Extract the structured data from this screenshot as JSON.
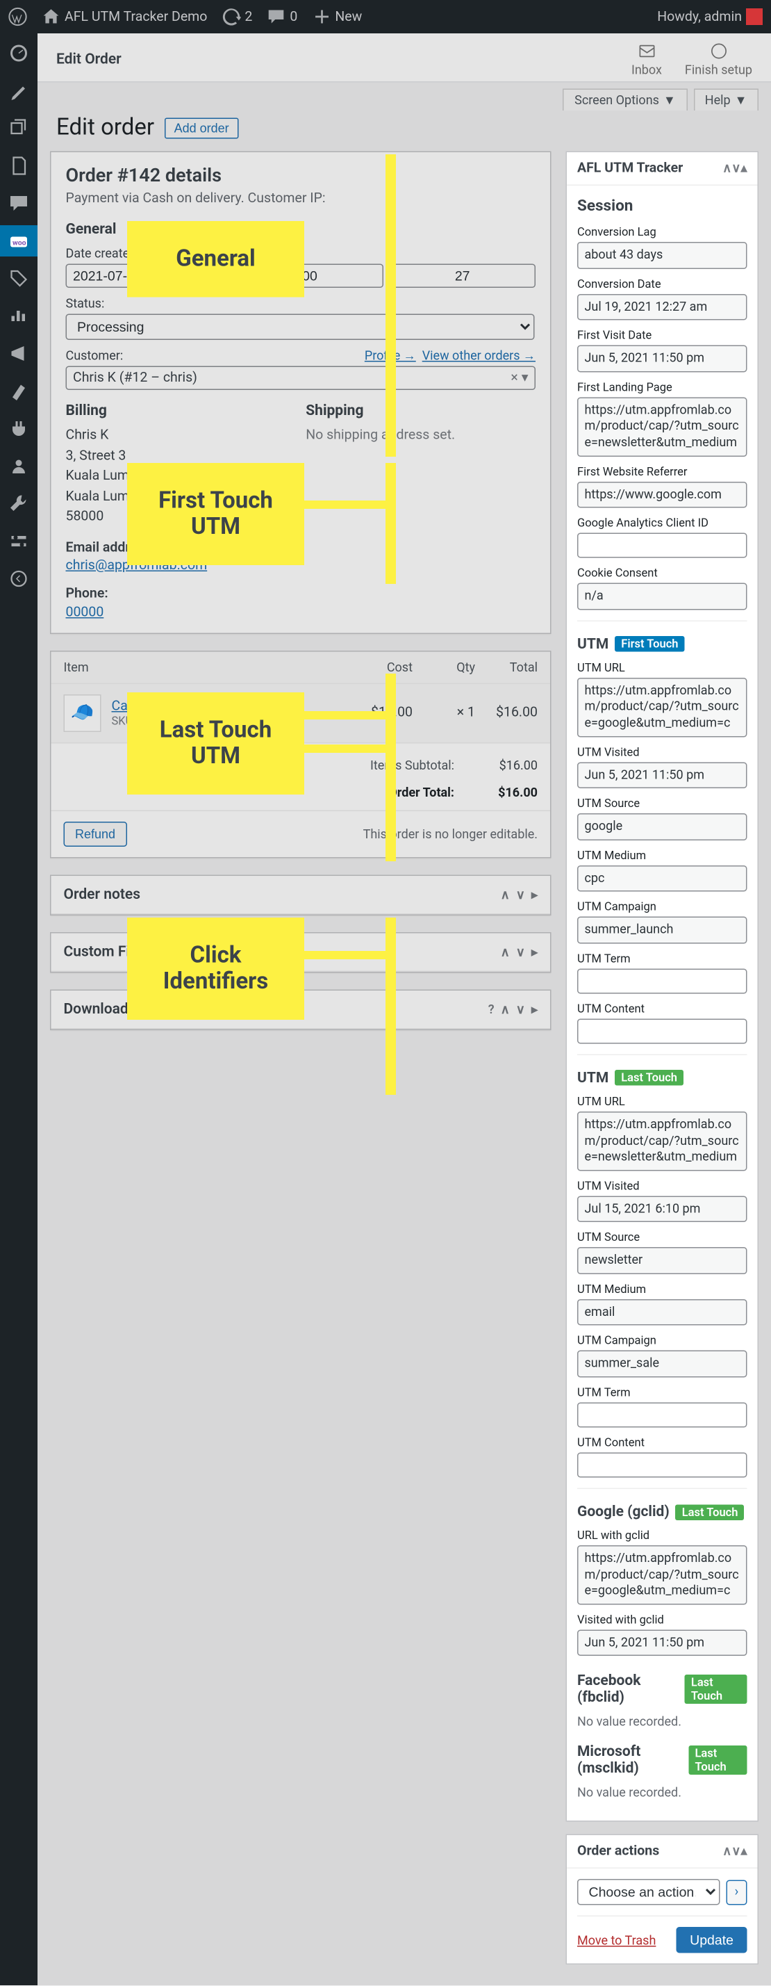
{
  "adminbar": {
    "site": "AFL UTM Tracker Demo",
    "updates": "2",
    "comments": "0",
    "new": "New",
    "howdy": "Howdy, admin"
  },
  "header": {
    "title": "Edit Order",
    "inbox": "Inbox",
    "finish": "Finish setup",
    "screen_options": "Screen Options",
    "help": "Help"
  },
  "page": {
    "title": "Edit order",
    "add": "Add order"
  },
  "order": {
    "heading": "Order #142 details",
    "sub": "Payment via Cash on delivery. Customer IP:",
    "general": "General",
    "date_label": "Date created:",
    "date": "2021-07-19",
    "at": "@",
    "hour": "00",
    "min": "27",
    "status_label": "Status:",
    "status": "Processing",
    "customer_label": "Customer:",
    "profile": "Profile →",
    "view_orders": "View other orders →",
    "customer": "Chris K (#12 – chris)",
    "billing": "Billing",
    "addr1": "Chris K",
    "addr2": "3, Street 3",
    "addr3": "Kuala Lumpur",
    "addr4": "Kuala Lumpur",
    "addr5": "58000",
    "email_label": "Email address:",
    "email": "chris@appfromlab.com",
    "phone_label": "Phone:",
    "phone": "00000",
    "shipping": "Shipping",
    "no_ship": "No shipping address set."
  },
  "items": {
    "col_item": "Item",
    "col_cost": "Cost",
    "col_qty": "Qty",
    "col_total": "Total",
    "name": "Cap",
    "sku": "SKU: woo-cap",
    "cost": "$16.00",
    "qty": "× 1",
    "total": "$16.00",
    "subtotal_label": "Items Subtotal:",
    "subtotal": "$16.00",
    "order_total_label": "Order Total:",
    "order_total": "$16.00",
    "refund": "Refund",
    "no_edit": "This order is no longer editable."
  },
  "boxes": {
    "notes": "Order notes",
    "custom": "Custom Fields",
    "download": "Downloadable product permissions"
  },
  "tracker": {
    "title": "AFL UTM Tracker",
    "session": "Session",
    "conv_lag_label": "Conversion Lag",
    "conv_lag": "about 43 days",
    "conv_date_label": "Conversion Date",
    "conv_date": "Jul 19, 2021 12:27 am",
    "first_visit_label": "First Visit Date",
    "first_visit": "Jun 5, 2021 11:50 pm",
    "first_landing_label": "First Landing Page",
    "first_landing": "https://utm.appfromlab.com/product/cap/?utm_source=newsletter&utm_medium",
    "first_ref_label": "First Website Referrer",
    "first_ref": "https://www.google.com",
    "ga_cid_label": "Google Analytics Client ID",
    "cookie_label": "Cookie Consent",
    "cookie": "n/a",
    "utm": "UTM",
    "first_touch": "First Touch",
    "last_touch": "Last Touch",
    "utm_url_label": "UTM URL",
    "ft_url": "https://utm.appfromlab.com/product/cap/?utm_source=google&utm_medium=c",
    "utm_visited_label": "UTM Visited",
    "ft_visited": "Jun 5, 2021 11:50 pm",
    "utm_source_label": "UTM Source",
    "ft_source": "google",
    "utm_medium_label": "UTM Medium",
    "ft_medium": "cpc",
    "utm_campaign_label": "UTM Campaign",
    "ft_campaign": "summer_launch",
    "utm_term_label": "UTM Term",
    "utm_content_label": "UTM Content",
    "lt_url": "https://utm.appfromlab.com/product/cap/?utm_source=newsletter&utm_medium",
    "lt_visited": "Jul 15, 2021 6:10 pm",
    "lt_source": "newsletter",
    "lt_medium": "email",
    "lt_campaign": "summer_sale",
    "gclid_head": "Google (gclid)",
    "gclid_url_label": "URL with gclid",
    "gclid_url": "https://utm.appfromlab.com/product/cap/?utm_source=google&utm_medium=c",
    "gclid_visited_label": "Visited with gclid",
    "gclid_visited": "Jun 5, 2021 11:50 pm",
    "fbclid_head": "Facebook (fbclid)",
    "msclkid_head": "Microsoft (msclkid)",
    "no_value": "No value recorded."
  },
  "actions": {
    "title": "Order actions",
    "choose": "Choose an action…",
    "trash": "Move to Trash",
    "update": "Update"
  },
  "callouts": {
    "general": "General",
    "first": "First Touch UTM",
    "last": "Last Touch UTM",
    "click": "Click Identifiers"
  }
}
